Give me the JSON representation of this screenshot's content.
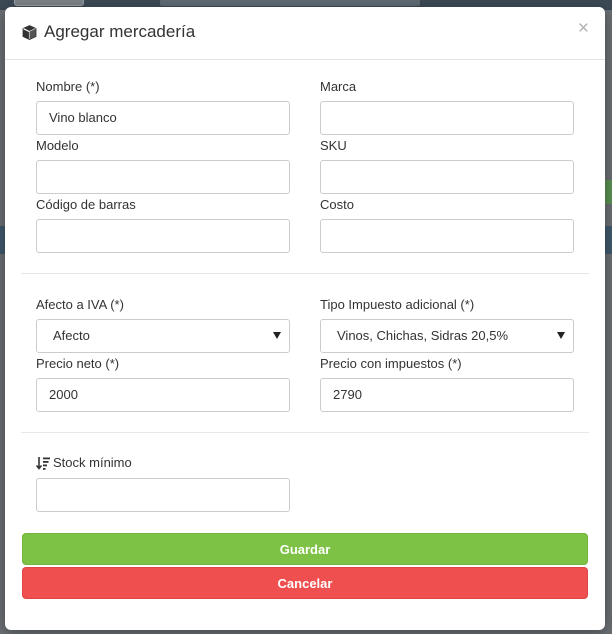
{
  "modal": {
    "title": "Agregar mercadería",
    "close_symbol": "×",
    "title_icon": "cube-icon"
  },
  "fields": {
    "nombre": {
      "label": "Nombre (*)",
      "value": "Vino blanco"
    },
    "marca": {
      "label": "Marca",
      "value": ""
    },
    "modelo": {
      "label": "Modelo",
      "value": ""
    },
    "sku": {
      "label": "SKU",
      "value": ""
    },
    "codigo_barras": {
      "label": "Código de barras",
      "value": ""
    },
    "costo": {
      "label": "Costo",
      "value": ""
    },
    "afecto_iva": {
      "label": "Afecto a IVA (*)",
      "selected": "Afecto"
    },
    "tipo_impuesto": {
      "label": "Tipo Impuesto adicional (*)",
      "selected": "Vinos, Chichas, Sidras 20,5%"
    },
    "precio_neto": {
      "label": "Precio neto (*)",
      "value": "2000"
    },
    "precio_impuestos": {
      "label": "Precio con impuestos (*)",
      "value": "2790"
    },
    "stock_minimo": {
      "label": "Stock mínimo",
      "value": "",
      "icon": "sort-amount-icon"
    }
  },
  "buttons": {
    "save_label": "Guardar",
    "cancel_label": "Cancelar"
  },
  "colors": {
    "save": "#7dc145",
    "cancel": "#f04f4f"
  }
}
